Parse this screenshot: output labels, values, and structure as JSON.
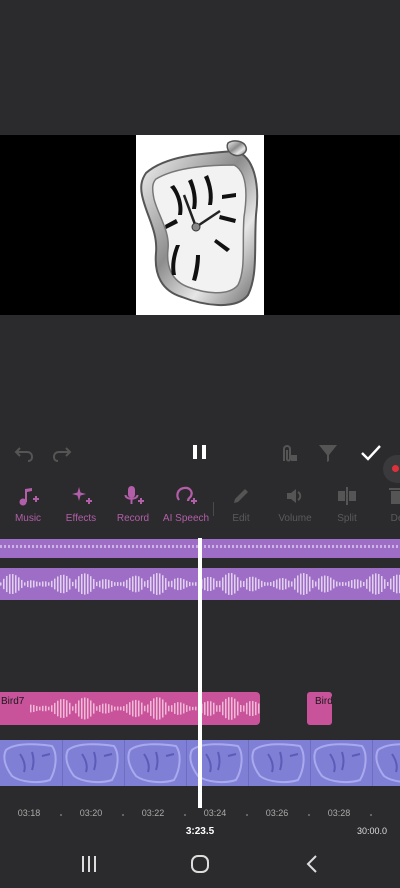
{
  "transport": {
    "undo_icon": "undo-icon",
    "redo_icon": "redo-icon",
    "pause_icon": "pause-icon",
    "clip_icon": "clip-icon",
    "filter_icon": "filter-icon",
    "confirm_icon": "checkmark-icon"
  },
  "toolbar": {
    "items": [
      {
        "label": "Music",
        "icon": "music-plus-icon",
        "enabled": true
      },
      {
        "label": "Effects",
        "icon": "sparkle-plus-icon",
        "enabled": true
      },
      {
        "label": "Record",
        "icon": "mic-plus-icon",
        "enabled": true
      },
      {
        "label": "AI Speech",
        "icon": "voice-plus-icon",
        "enabled": true
      },
      {
        "label": "Edit",
        "icon": "pencil-icon",
        "enabled": false
      },
      {
        "label": "Volume",
        "icon": "speaker-icon",
        "enabled": false
      },
      {
        "label": "Split",
        "icon": "split-icon",
        "enabled": false
      },
      {
        "label": "De",
        "icon": "delete-icon",
        "enabled": false
      }
    ]
  },
  "timeline": {
    "sound_clips": [
      {
        "label": "Bird7"
      },
      {
        "label": "Bird"
      }
    ],
    "ruler": [
      "03:18",
      "03:20",
      "03:22",
      "03:24",
      "03:26",
      "03:28"
    ],
    "current_time": "3:23.5",
    "total_time": "30:00.0"
  },
  "colors": {
    "background": "#2b2b2d",
    "accent": "#b35ea9",
    "music_track": "#9e6ec6",
    "sound_clip": "#c9539b",
    "video_track": "#7f7fd6"
  },
  "nav": {
    "recents_icon": "recents-icon",
    "home_icon": "home-icon",
    "back_icon": "back-icon"
  }
}
